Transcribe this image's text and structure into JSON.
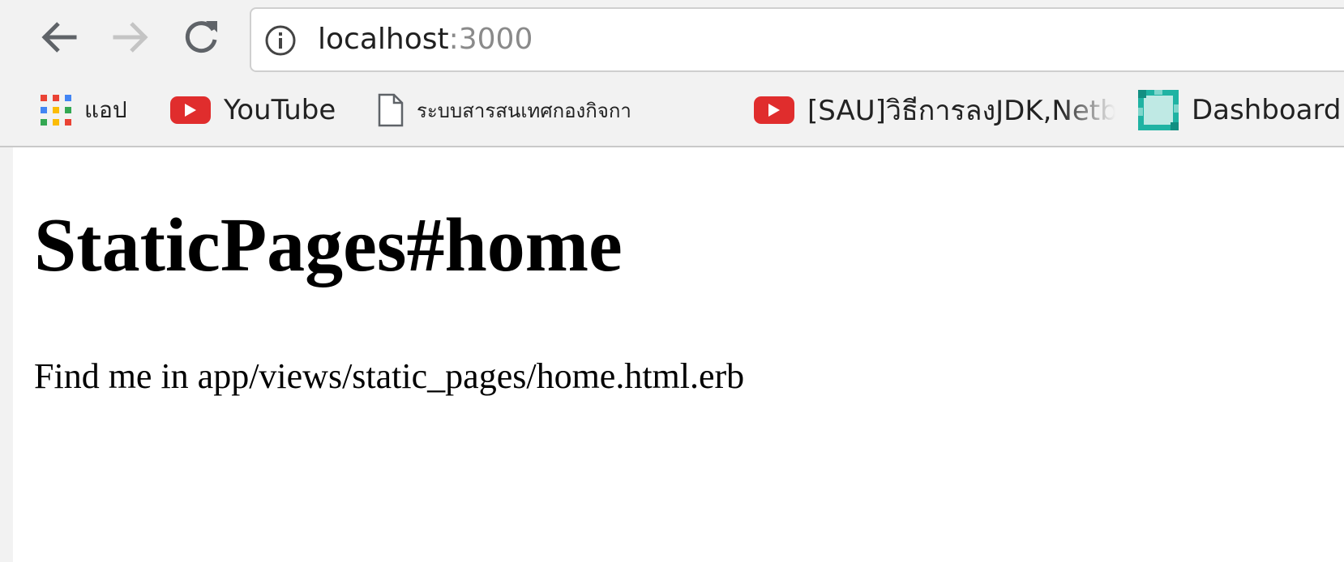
{
  "browser": {
    "nav": {
      "back_icon": "arrow-left-icon",
      "forward_icon": "arrow-right-icon",
      "reload_icon": "reload-icon"
    },
    "address_bar": {
      "info_icon": "info-icon",
      "host": "localhost",
      "port": ":3000"
    },
    "bookmarks": [
      {
        "label": "แอป",
        "icon": "apps-grid-icon"
      },
      {
        "label": "YouTube",
        "icon": "youtube-icon"
      },
      {
        "label": "ระบบสารสนเทศกองกิจกา",
        "icon": "document-icon"
      },
      {
        "label": "[SAU]วิธีการลงJDK,Netb",
        "icon": "youtube-icon"
      },
      {
        "label": "Dashboard",
        "icon": "dashboard-icon"
      }
    ],
    "colors": {
      "chrome_bg": "#f2f2f2",
      "youtube_red": "#e02d2d",
      "dashboard_teal": "#1fb3a3"
    }
  },
  "page": {
    "title": "StaticPages#home",
    "body_text": "Find me in app/views/static_pages/home.html.erb"
  }
}
